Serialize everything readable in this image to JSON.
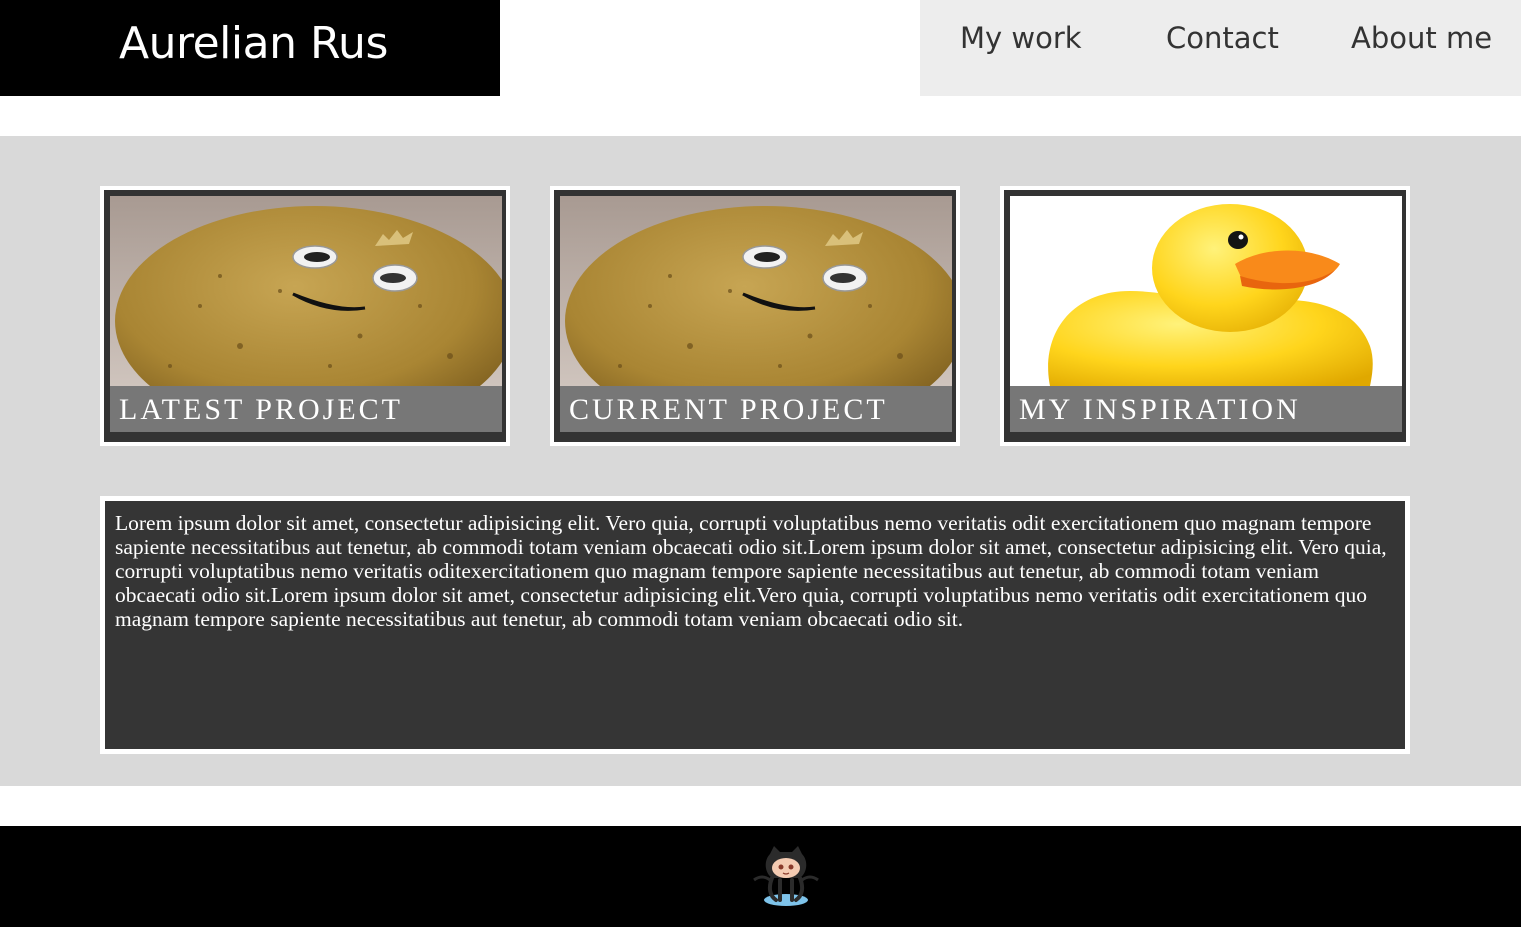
{
  "header": {
    "brand": "Aurelian Rus",
    "nav": [
      "My work",
      "Contact",
      "About me"
    ]
  },
  "cards": [
    {
      "label": "LATEST PROJECT",
      "image": "potato-with-googly-eyes"
    },
    {
      "label": "CURRENT PROJECT",
      "image": "potato-with-googly-eyes"
    },
    {
      "label": "MY INSPIRATION",
      "image": "yellow-rubber-duck"
    }
  ],
  "content": {
    "paragraph": "Lorem ipsum dolor sit amet, consectetur adipisicing elit. Vero quia, corrupti voluptatibus nemo veritatis odit exercitationem quo magnam tempore sapiente necessitatibus aut tenetur, ab commodi totam veniam obcaecati odio sit.Lorem ipsum dolor sit amet, consectetur adipisicing elit. Vero quia, corrupti voluptatibus nemo veritatis oditexercitationem quo magnam tempore sapiente necessitatibus aut tenetur, ab commodi totam veniam obcaecati odio sit.Lorem ipsum dolor sit amet, consectetur adipisicing elit.Vero quia, corrupti voluptatibus nemo veritatis odit exercitationem quo magnam tempore sapiente necessitatibus aut tenetur, ab commodi totam veniam obcaecati odio sit."
  },
  "footer": {
    "icon": "github-octocat-icon"
  },
  "colors": {
    "header_bg": "#000000",
    "nav_bg": "#ededed",
    "main_bg": "#d9d9d9",
    "card_frame": "#333333",
    "label_bar": "#777777",
    "text_box_bg": "#353535"
  }
}
